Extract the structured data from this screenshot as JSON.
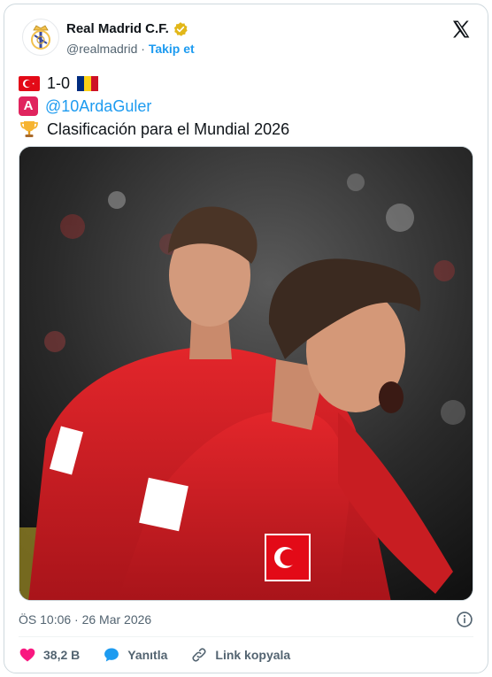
{
  "author": {
    "display_name": "Real Madrid C.F.",
    "handle": "@realmadrid",
    "separator": "·",
    "follow_label": "Takip et"
  },
  "tweet": {
    "score_text": "1-0",
    "mention": "@10ArdaGuler",
    "badge_letter": "A",
    "competition": "Clasificación para el Mundial 2026"
  },
  "meta": {
    "timestamp": "ÖS 10:06 · 26 Mar 2026"
  },
  "actions": {
    "likes": "38,2 B",
    "reply_label": "Yanıtla",
    "copy_link_label": "Link kopyala"
  },
  "colors": {
    "accent": "#1d9bf0",
    "like": "#f91880",
    "turkey_red": "#e30a17"
  }
}
